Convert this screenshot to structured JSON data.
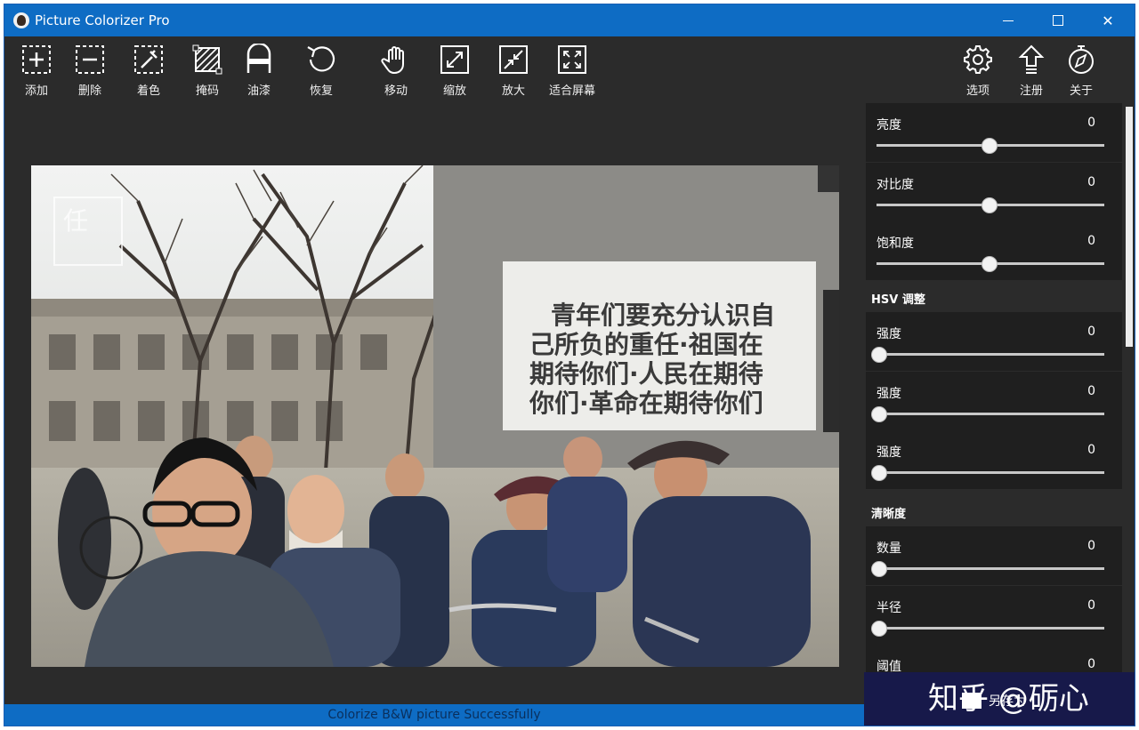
{
  "window": {
    "title": "Picture Colorizer Pro"
  },
  "toolbar": {
    "left": [
      {
        "label": "添加",
        "icon": "add-icon"
      },
      {
        "label": "删除",
        "icon": "delete-icon"
      },
      {
        "label": "着色",
        "icon": "colorize-icon"
      },
      {
        "label": "掩码",
        "icon": "mask-icon"
      },
      {
        "label": "油漆",
        "icon": "paint-icon"
      },
      {
        "label": "恢复",
        "icon": "undo-icon"
      },
      {
        "label": "移动",
        "icon": "hand-icon"
      },
      {
        "label": "缩放",
        "icon": "zoom-icon"
      },
      {
        "label": "放大",
        "icon": "enlarge-icon"
      },
      {
        "label": "适合屏幕",
        "icon": "fit-screen-icon"
      }
    ],
    "right": [
      {
        "label": "选项",
        "icon": "gear-icon"
      },
      {
        "label": "注册",
        "icon": "register-icon"
      },
      {
        "label": "关于",
        "icon": "about-icon"
      }
    ]
  },
  "photo": {
    "slogan_lines": [
      "青年们要充分认识自",
      "己所负的重任·祖国在",
      "期待你们·人民在期待",
      "你们·革命在期待你们"
    ],
    "corner_seal": "任"
  },
  "panel": {
    "basic": [
      {
        "label": "亮度",
        "value": "0",
        "position": 0.5
      },
      {
        "label": "对比度",
        "value": "0",
        "position": 0.5
      },
      {
        "label": "饱和度",
        "value": "0",
        "position": 0.5
      }
    ],
    "hsv_title": "HSV 调整",
    "hsv": [
      {
        "label": "强度",
        "value": "0",
        "position": 0.0
      },
      {
        "label": "强度",
        "value": "0",
        "position": 0.0
      },
      {
        "label": "强度",
        "value": "0",
        "position": 0.0
      }
    ],
    "sharpness_title": "清晰度",
    "sharpness": [
      {
        "label": "数量",
        "value": "0",
        "position": 0.0
      },
      {
        "label": "半径",
        "value": "0",
        "position": 0.0
      },
      {
        "label": "阈值",
        "value": "0",
        "position": 0.0
      }
    ]
  },
  "save": {
    "label": "另存为"
  },
  "watermark": {
    "text": "知乎 @砺心"
  },
  "status": {
    "message": "Colorize B&W picture Successfully"
  }
}
